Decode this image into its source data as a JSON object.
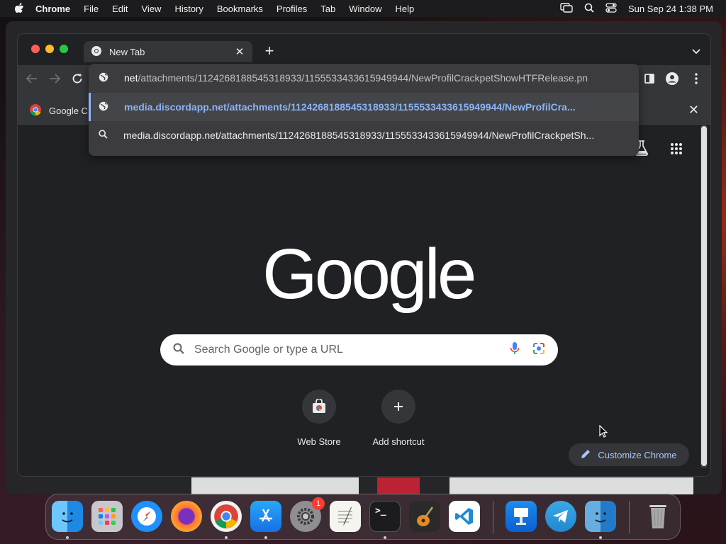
{
  "menubar": {
    "app": "Chrome",
    "items": [
      "File",
      "Edit",
      "View",
      "History",
      "Bookmarks",
      "Profiles",
      "Tab",
      "Window",
      "Help"
    ],
    "clock": "Sun Sep 24  1:38 PM"
  },
  "tab": {
    "title": "New Tab"
  },
  "omnibox": {
    "input_strong": "net",
    "input_rest": "/attachments/1124268188545318933/1155533433615949944/NewProfilCrackpetShowHTFRelease.pn",
    "suggestion_selected": "media.discordapp.net/attachments/1124268188545318933/1155533433615949944/NewProfilCra...",
    "suggestion_search": "media.discordapp.net/attachments/1124268188545318933/1155533433615949944/NewProfilCrackpetSh..."
  },
  "bookmarks": {
    "item": "Google C"
  },
  "ntp": {
    "logo": "Google",
    "search_placeholder": "Search Google or type a URL",
    "shortcuts": [
      {
        "label": "Web Store",
        "icon": "webstore-icon"
      },
      {
        "label": "Add shortcut",
        "icon": "plus-icon"
      }
    ],
    "customize": "Customize Chrome"
  },
  "dock": {
    "apps": [
      "Finder",
      "Launchpad",
      "Safari",
      "Firefox",
      "Chrome",
      "App Store",
      "System Settings",
      "TextEdit",
      "Terminal",
      "GarageBand",
      "VS Code",
      "Keynote",
      "Telegram",
      "Finder",
      "Trash"
    ],
    "settings_badge": "1"
  },
  "colors": {
    "accent": "#8ab4f8",
    "omnibox_bg": "#3c3c3f",
    "toolbar": "#35363a",
    "page": "#202124"
  }
}
